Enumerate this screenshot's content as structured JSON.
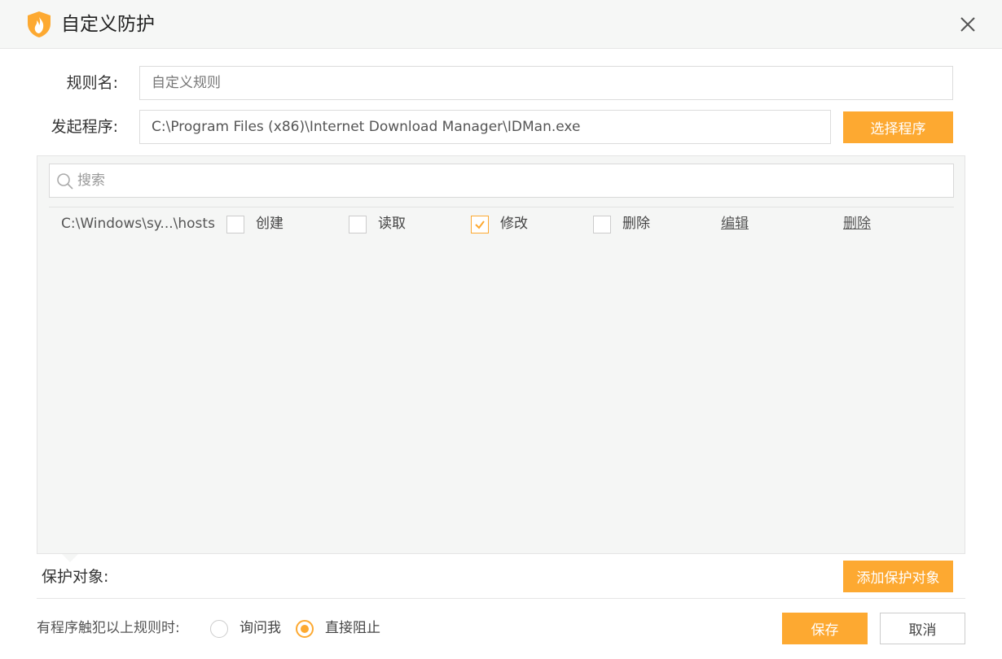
{
  "window": {
    "title": "自定义防护",
    "logo_icon": "flame-shield-icon",
    "close_icon": "close-icon"
  },
  "form": {
    "rule_name_label": "规则名:",
    "rule_name_value": "",
    "rule_name_placeholder": "自定义规则",
    "program_label": "发起程序:",
    "program_value": "C:\\Program Files (x86)\\Internet Download Manager\\IDMan.exe",
    "select_program_label": "选择程序"
  },
  "protect_panel": {
    "search_placeholder": "搜索",
    "rows": [
      {
        "path": "C:\\Windows\\sy...\\hosts",
        "options": [
          {
            "label": "创建",
            "checked": false
          },
          {
            "label": "读取",
            "checked": false
          },
          {
            "label": "修改",
            "checked": true
          },
          {
            "label": "删除",
            "checked": false
          }
        ],
        "edit_label": "编辑",
        "delete_label": "删除"
      }
    ]
  },
  "protected_label": "保护对象:",
  "add_protected_label": "添加保护对象",
  "footer": {
    "trigger_label": "有程序触犯以上规则时:",
    "options": [
      {
        "label": "询问我",
        "selected": false
      },
      {
        "label": "直接阻止",
        "selected": true
      }
    ],
    "save_label": "保存",
    "cancel_label": "取消"
  },
  "colors": {
    "accent": "#fda931",
    "titlebar_bg": "#f6f7f6",
    "panel_bg": "#f5f6f5"
  }
}
